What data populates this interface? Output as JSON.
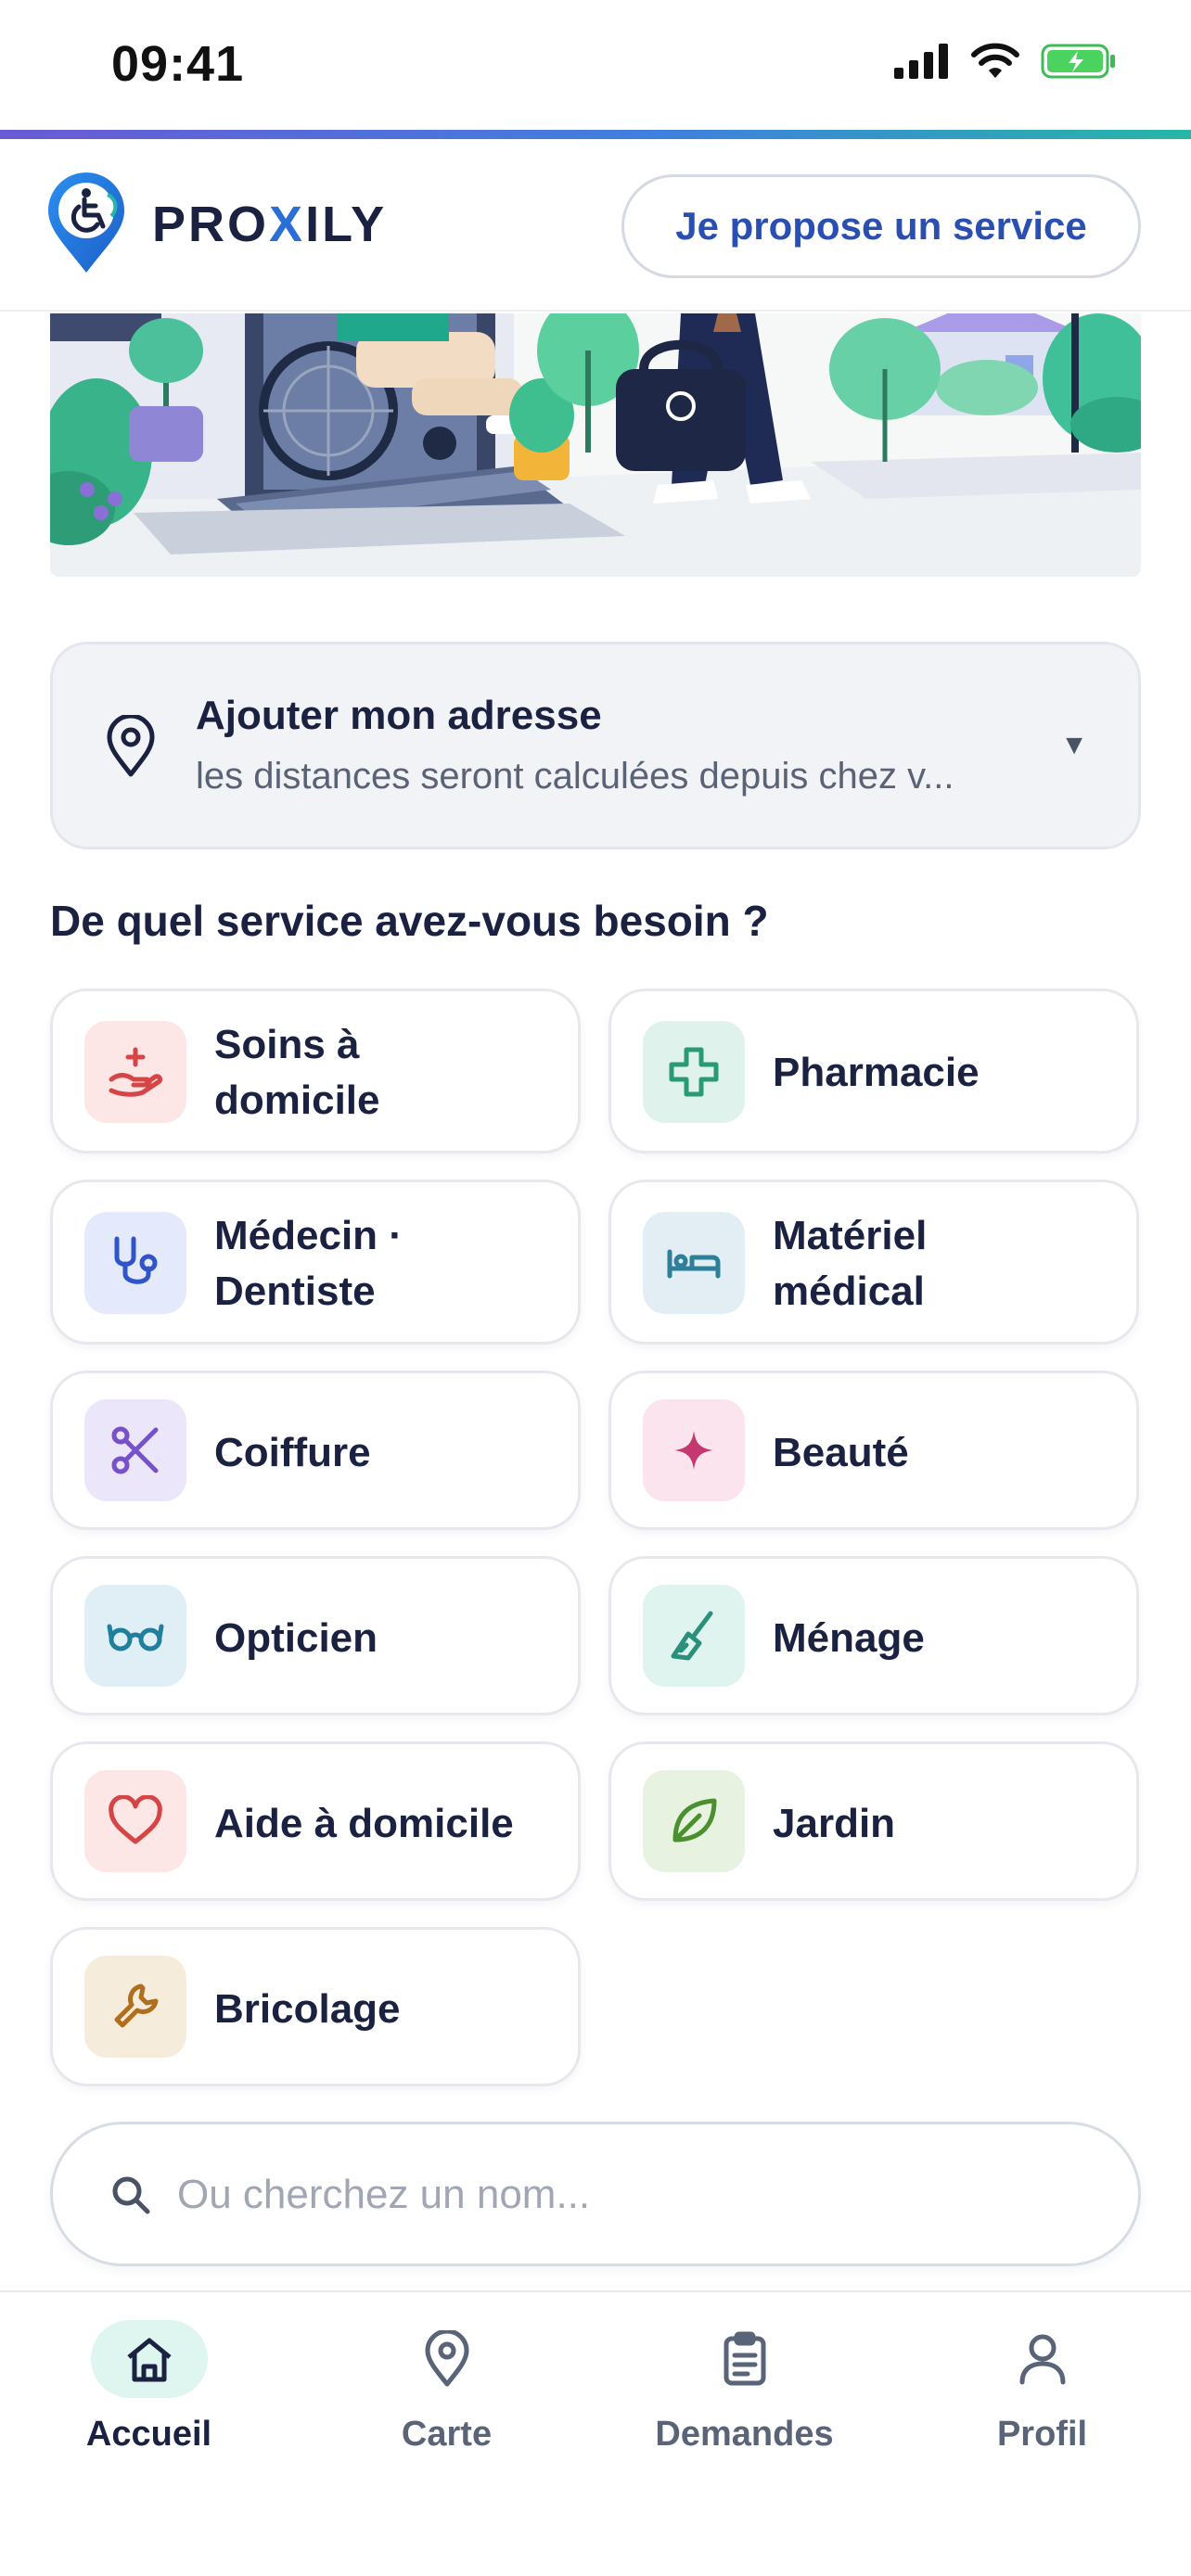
{
  "status_bar": {
    "time": "09:41"
  },
  "header": {
    "logo_prefix": "PRO",
    "logo_x": "X",
    "logo_suffix": "ILY",
    "propose_button": "Je propose un service"
  },
  "address": {
    "title": "Ajouter mon adresse",
    "subtitle": "les distances seront calculées depuis chez v..."
  },
  "section_title": "De quel service avez-vous besoin ?",
  "services": [
    {
      "label_line1": "Soins à",
      "label_line2": "domicile",
      "icon": "hand-care-icon",
      "icon_bg": "#fde6e6",
      "icon_color": "#d64545"
    },
    {
      "label_line1": "Pharmacie",
      "label_line2": "",
      "icon": "pharmacy-cross-icon",
      "icon_bg": "#dff3ec",
      "icon_color": "#2a9a74"
    },
    {
      "label_line1": "Médecin ·",
      "label_line2": "Dentiste",
      "icon": "stethoscope-icon",
      "icon_bg": "#e4e9fb",
      "icon_color": "#2f55c8"
    },
    {
      "label_line1": "Matériel",
      "label_line2": "médical",
      "icon": "hospital-bed-icon",
      "icon_bg": "#e2eef3",
      "icon_color": "#2d7f9a"
    },
    {
      "label_line1": "Coiffure",
      "label_line2": "",
      "icon": "scissors-icon",
      "icon_bg": "#ece6fb",
      "icon_color": "#7651c9"
    },
    {
      "label_line1": "Beauté",
      "label_line2": "",
      "icon": "sparkle-icon",
      "icon_bg": "#fbe4ee",
      "icon_color": "#c2386f"
    },
    {
      "label_line1": "Opticien",
      "label_line2": "",
      "icon": "glasses-icon",
      "icon_bg": "#e0eff5",
      "icon_color": "#1f7f9d"
    },
    {
      "label_line1": "Ménage",
      "label_line2": "",
      "icon": "broom-icon",
      "icon_bg": "#dff3ef",
      "icon_color": "#2a8f7b"
    },
    {
      "label_line1": "Aide à domicile",
      "label_line2": "",
      "icon": "heart-icon",
      "icon_bg": "#fde6e6",
      "icon_color": "#d64545"
    },
    {
      "label_line1": "Jardin",
      "label_line2": "",
      "icon": "leaf-icon",
      "icon_bg": "#e7f3e0",
      "icon_color": "#4b8f2e"
    },
    {
      "label_line1": "Bricolage",
      "label_line2": "",
      "icon": "wrench-icon",
      "icon_bg": "#f6ecdc",
      "icon_color": "#b06e1f"
    }
  ],
  "search": {
    "placeholder": "Ou cherchez un nom..."
  },
  "nav": [
    {
      "label": "Accueil",
      "icon": "home-icon",
      "active": true
    },
    {
      "label": "Carte",
      "icon": "map-pin-icon",
      "active": false
    },
    {
      "label": "Demandes",
      "icon": "clipboard-icon",
      "active": false
    },
    {
      "label": "Profil",
      "icon": "user-icon",
      "active": false
    }
  ],
  "colors": {
    "brand_dark": "#1b2140",
    "brand_blue": "#2a6fd8",
    "accent_teal": "#26b6a6",
    "active_nav_bg": "#dff5f0"
  }
}
